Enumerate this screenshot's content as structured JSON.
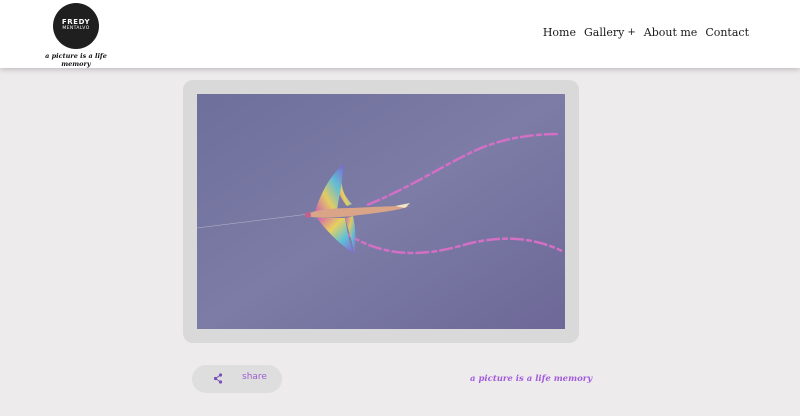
{
  "header": {
    "logo": {
      "name": "FREDY",
      "surname": "MENTALVO"
    },
    "tagline": "a picture is a life memory",
    "nav": [
      {
        "label": "Home",
        "has_submenu": false
      },
      {
        "label": "Gallery",
        "has_submenu": true,
        "submenu_marker": "+"
      },
      {
        "label": "About me",
        "has_submenu": false
      },
      {
        "label": "Contact",
        "has_submenu": false
      }
    ]
  },
  "photo": {
    "subject": "dragon kite flying in a violet sky"
  },
  "share": {
    "label": "share",
    "icon": "share-icon"
  },
  "footer": {
    "tagline": "a picture is a life memory"
  },
  "colors": {
    "page_background": "#edebec",
    "header_background": "#ffffff",
    "frame": "#d9d9d9",
    "sky": "#7a7aa6",
    "accent_purple": "#a25bdc"
  }
}
